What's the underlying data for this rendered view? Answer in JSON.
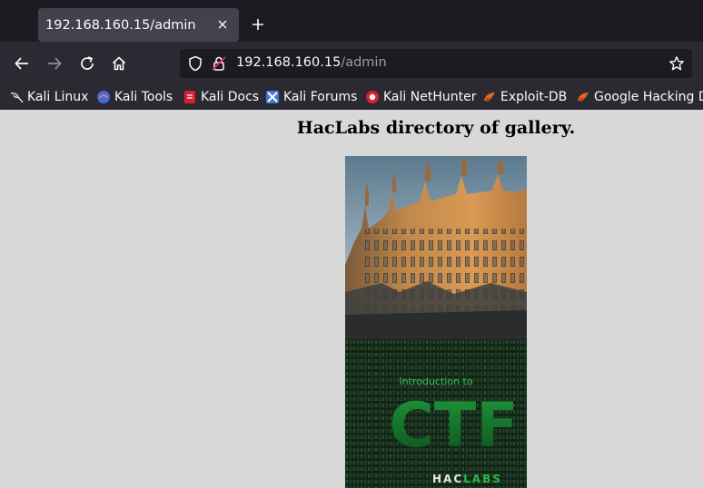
{
  "browser": {
    "tab": {
      "title": "192.168.160.15/admin"
    },
    "url": {
      "host": "192.168.160.15",
      "path": "/admin"
    },
    "bookmarks": [
      {
        "label": "Kali Linux",
        "icon": "kali-dragon-icon"
      },
      {
        "label": "Kali Tools",
        "icon": "kali-tools-icon"
      },
      {
        "label": "Kali Docs",
        "icon": "kali-docs-icon"
      },
      {
        "label": "Kali Forums",
        "icon": "kali-forums-icon"
      },
      {
        "label": "Kali NetHunter",
        "icon": "kali-nethunter-icon"
      },
      {
        "label": "Exploit-DB",
        "icon": "exploit-db-icon"
      },
      {
        "label": "Google Hacking DB",
        "icon": "ghdb-icon"
      }
    ]
  },
  "page": {
    "heading": "HacLabs directory of gallery.",
    "cover": {
      "subtitle": "Introduction to",
      "title": "CTF",
      "brand_hac": "HAC",
      "brand_labs": "LABS"
    }
  },
  "colors": {
    "accent_green": "#2fb84a",
    "page_background": "#d8d8d8",
    "toolbar": "#2b2a33"
  }
}
